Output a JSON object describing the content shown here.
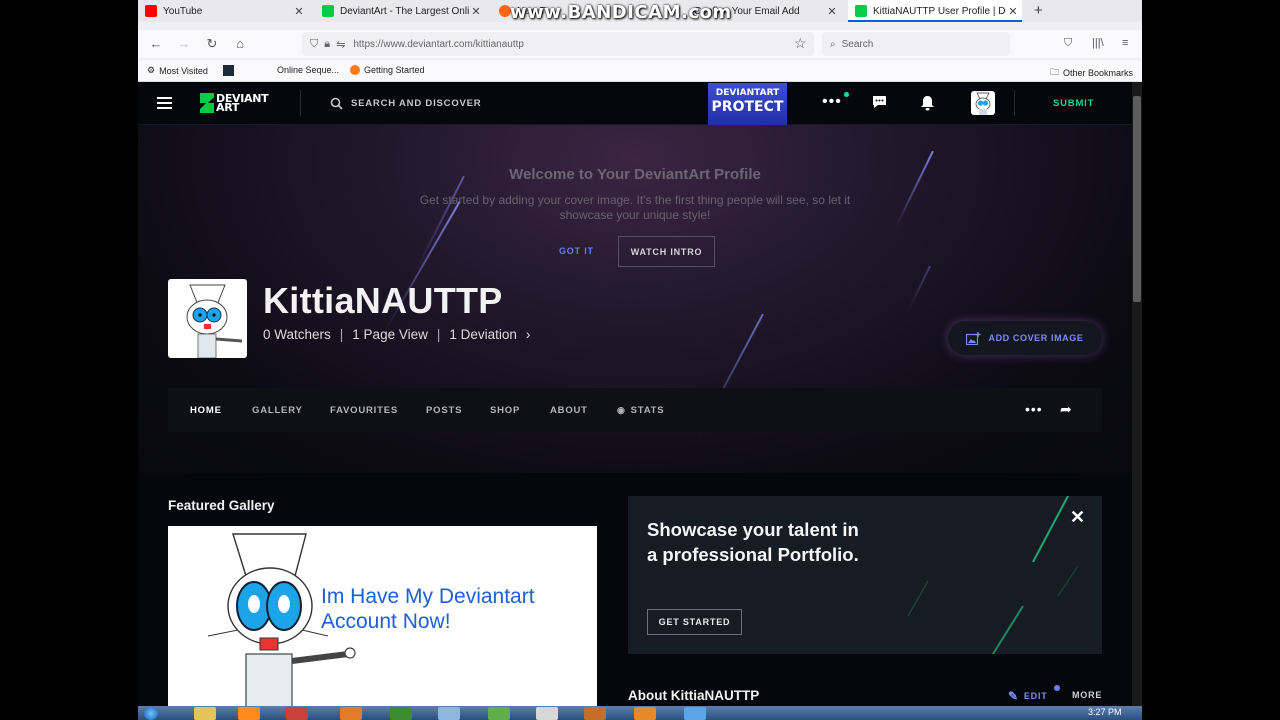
{
  "browser": {
    "tabs": [
      {
        "label": "YouTube",
        "icon_color": "#ff0000"
      },
      {
        "label": "DeviantArt - The Largest Online",
        "icon_color": "#05cc47"
      },
      {
        "label": "New T",
        "icon_color": "#ff6611"
      },
      {
        "label": "Confirm Your Email Add",
        "icon_color": "#05cc47"
      },
      {
        "label": "KittiaNAUTTP User Profile | Devi",
        "icon_color": "#05cc47",
        "active": true
      }
    ],
    "watermark": "www.BANDICAM.com",
    "url": "https://www.deviantart.com/kittianauttp",
    "search_placeholder": "Search",
    "bookmarks": {
      "most_visited": "Most Visited",
      "online_seq": "Online Seque...",
      "getting_started": "Getting Started",
      "other": "Other Bookmarks"
    }
  },
  "header": {
    "logo_line1": "DEVIANT",
    "logo_line2": "ART",
    "search_label": "SEARCH AND DISCOVER",
    "protect_line1": "DEVIANTART",
    "protect_line2": "PROTECT",
    "submit_label": "SUBMIT"
  },
  "welcome": {
    "title": "Welcome to Your DeviantArt Profile",
    "text": "Get started by adding your cover image. It's the first thing people will see, so let it showcase your unique style!",
    "got_it": "GOT IT",
    "watch_intro": "WATCH INTRO"
  },
  "profile": {
    "username": "KittiaNAUTTP",
    "watchers": "0 Watchers",
    "page_views": "1 Page View",
    "deviations": "1 Deviation",
    "add_cover": "ADD COVER IMAGE"
  },
  "profile_tabs": [
    "HOME",
    "GALLERY",
    "FAVOURITES",
    "POSTS",
    "SHOP",
    "ABOUT",
    "STATS"
  ],
  "featured": {
    "title": "Featured Gallery",
    "caption_line1": "Im Have My Deviantart",
    "caption_line2": "Account Now!"
  },
  "promo": {
    "title": "Showcase your talent in a professional Portfolio.",
    "button": "GET STARTED"
  },
  "about": {
    "title": "About KittiaNAUTTP",
    "edit": "EDIT",
    "more": "MORE"
  },
  "taskbar": {
    "clock": "3:27 PM"
  },
  "colors": {
    "da_green": "#05cc47",
    "accent_blue": "#7d8cf5",
    "submit_green": "#21d38f"
  }
}
